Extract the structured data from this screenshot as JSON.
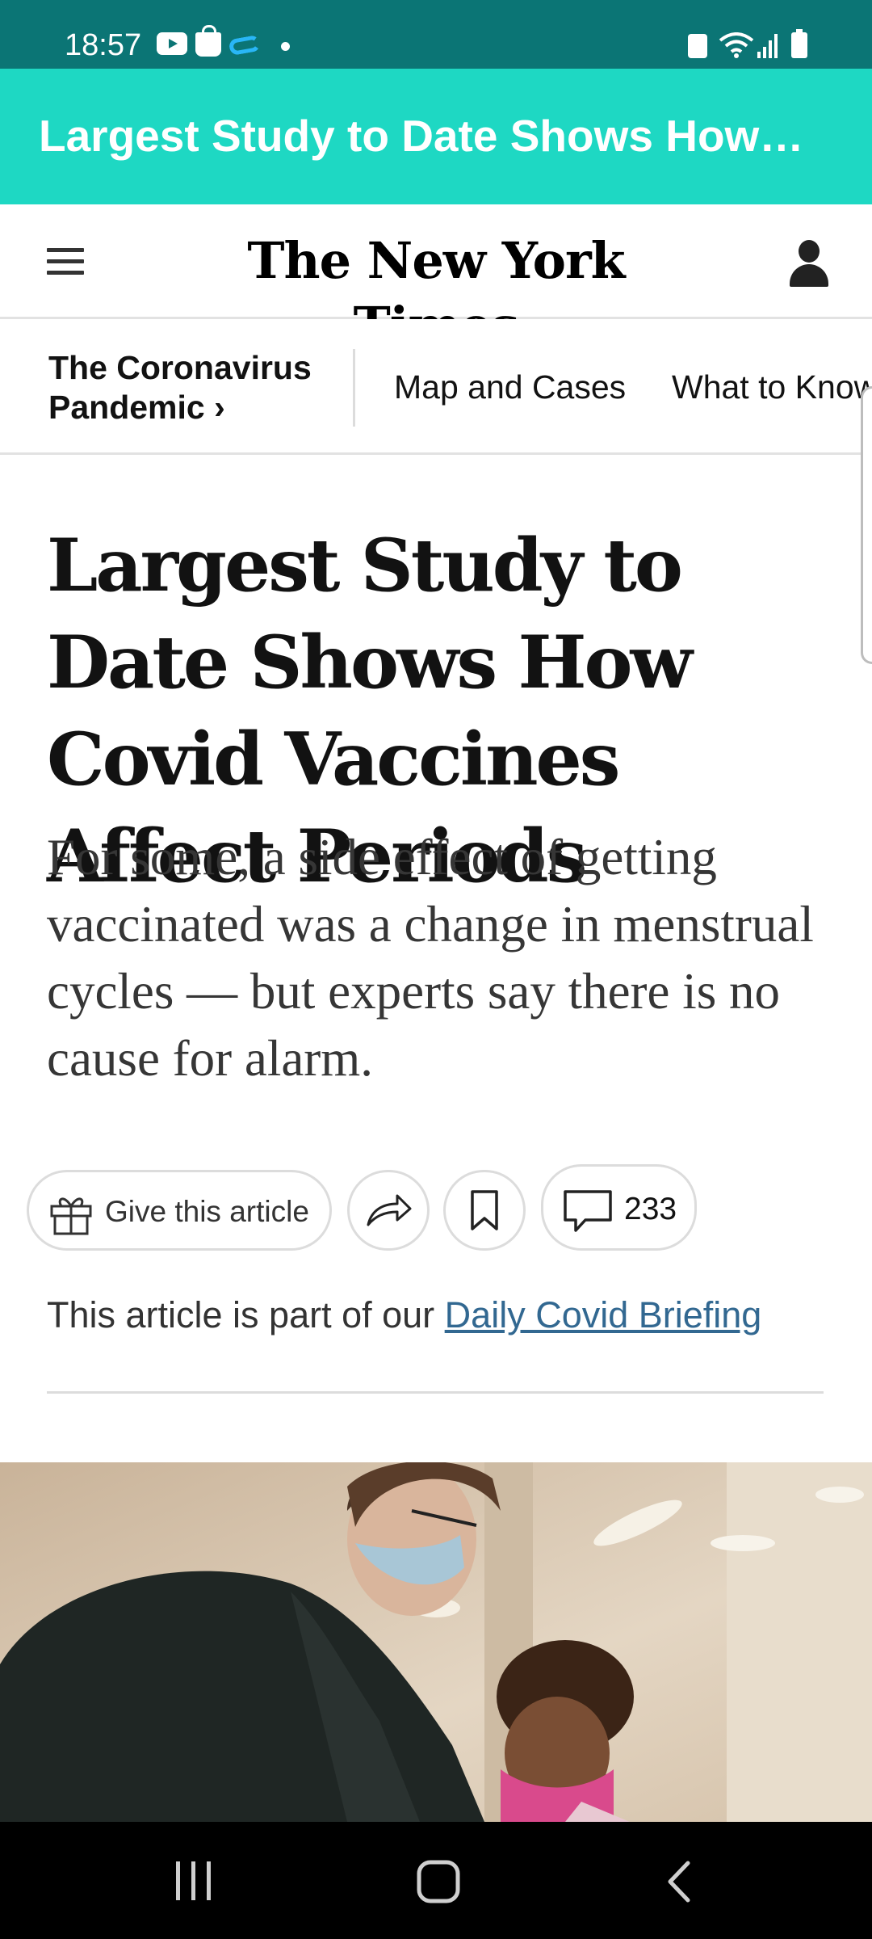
{
  "status_bar": {
    "time": "18:57",
    "icons": [
      "youtube-icon",
      "shopping-bag-icon",
      "cloud-icon",
      "dot-icon",
      "sim-icon",
      "wifi-icon",
      "signal-icon",
      "battery-icon"
    ]
  },
  "app_bar": {
    "title": "Largest Study to Date Shows How…",
    "color": "#1ed8c3"
  },
  "header": {
    "masthead": "The New York Times",
    "menu_icon": "hamburger-menu-icon",
    "account_icon": "user-icon"
  },
  "section_nav": {
    "section_label": "The Coronavirus Pandemic ›",
    "links": [
      "Map and Cases",
      "What to Know"
    ]
  },
  "article": {
    "headline": "Largest Study to Date Shows How Covid Vaccines Affect Periods",
    "summary": "For some, a side effect of getting vaccinated was a change in menstrual cycles — but experts say there is no cause for alarm.",
    "actions": {
      "gift_label": "Give this article",
      "comment_count": "233"
    },
    "briefing_prefix": "This article is part of our ",
    "briefing_link": "Daily Covid Briefing",
    "link_color": "#326891"
  },
  "photo": {
    "description_icon": "article-photo"
  },
  "system_nav": {
    "icons": [
      "recent-apps-icon",
      "home-icon",
      "back-icon"
    ]
  }
}
